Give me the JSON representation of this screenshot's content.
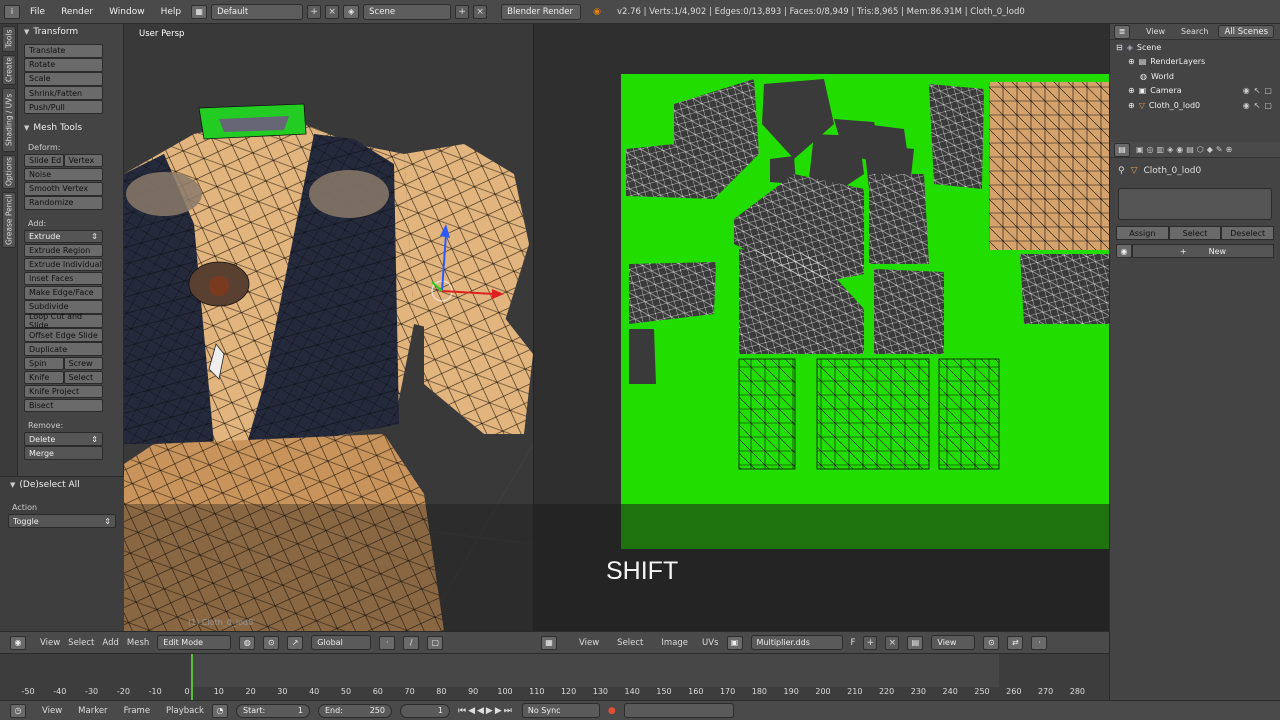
{
  "menus": [
    "File",
    "Render",
    "Window",
    "Help"
  ],
  "screen_layout": "Default",
  "scene": "Scene",
  "render_engine": "Blender Render",
  "stats": "v2.76 | Verts:1/4,902 | Edges:0/13,893 | Faces:0/8,949 | Tris:8,965 | Mem:86.91M | Cloth_0_lod0",
  "left_tabs": [
    "Tools",
    "Create",
    "Shading / UVs",
    "Options",
    "Grease Pencil"
  ],
  "transform": {
    "header": "Transform",
    "buttons": [
      "Translate",
      "Rotate",
      "Scale",
      "Shrink/Fatten",
      "Push/Pull"
    ]
  },
  "mesh_tools": {
    "header": "Mesh Tools",
    "deform_label": "Deform:",
    "slide_edge": "Slide Ed",
    "vertex": "Vertex",
    "noise": "Noise",
    "smooth_vertex": "Smooth Vertex",
    "randomize": "Randomize",
    "add_label": "Add:",
    "extrude": "Extrude",
    "add_buttons": [
      "Extrude Region",
      "Extrude Individual",
      "Inset Faces",
      "Make Edge/Face",
      "Subdivide",
      "Loop Cut and Slide",
      "Offset Edge Slide",
      "Duplicate"
    ],
    "spin": "Spin",
    "screw": "Screw",
    "knife": "Knife",
    "select": "Select",
    "knife_project": "Knife Project",
    "bisect": "Bisect",
    "remove_label": "Remove:",
    "delete": "Delete",
    "merge": "Merge"
  },
  "operator_panel": {
    "header": "(De)select All",
    "action_label": "Action",
    "action_value": "Toggle"
  },
  "viewport": {
    "label": "User Persp",
    "object_label": "(1) Cloth_0_lod0"
  },
  "uv_editor": {
    "key_overlay": "SHIFT",
    "background_color": "#22dd00"
  },
  "outliner": {
    "view": "View",
    "search": "Search",
    "filter": "All Scenes",
    "items": [
      "Scene",
      "RenderLayers",
      "World",
      "Camera",
      "Cloth_0_lod0"
    ]
  },
  "properties": {
    "object_name": "Cloth_0_lod0",
    "assign": "Assign",
    "select": "Select",
    "deselect": "Deselect",
    "new": "New"
  },
  "viewport_header": {
    "view": "View",
    "select": "Select",
    "add": "Add",
    "mesh": "Mesh",
    "mode": "Edit Mode",
    "orientation": "Global"
  },
  "uv_header": {
    "view": "View",
    "select": "Select",
    "image": "Image",
    "uvs": "UVs",
    "image_name": "Multiplier.dds",
    "f": "F",
    "view_drop": "View"
  },
  "timeline": {
    "ticks": [
      "-50",
      "-40",
      "-30",
      "-20",
      "-10",
      "0",
      "10",
      "20",
      "30",
      "40",
      "50",
      "60",
      "70",
      "80",
      "90",
      "100",
      "110",
      "120",
      "130",
      "140",
      "150",
      "160",
      "170",
      "180",
      "190",
      "200",
      "210",
      "220",
      "230",
      "240",
      "250",
      "260",
      "270",
      "280"
    ],
    "current_frame": 1,
    "view": "View",
    "marker": "Marker",
    "frame": "Frame",
    "playback": "Playback",
    "start_label": "Start:",
    "start_value": "1",
    "end_label": "End:",
    "end_value": "250",
    "current_value": "1",
    "sync": "No Sync"
  }
}
